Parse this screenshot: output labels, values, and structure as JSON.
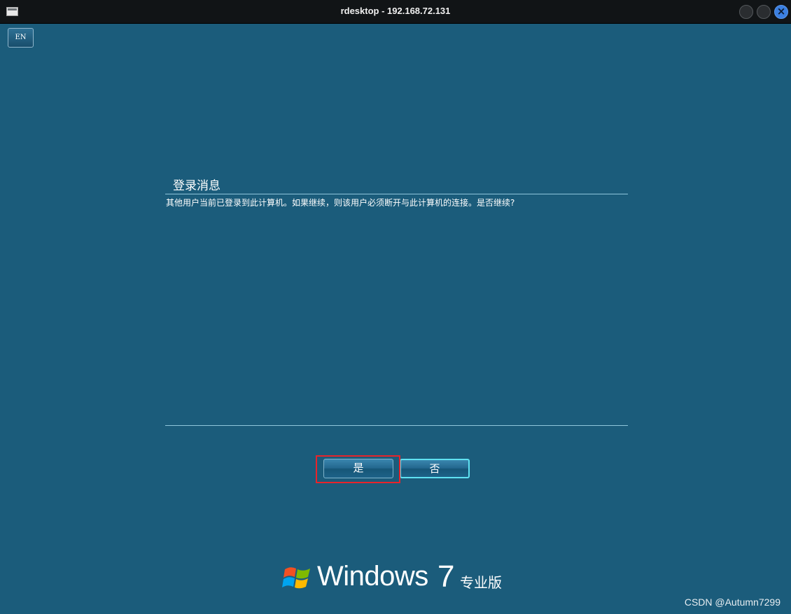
{
  "window": {
    "title": "rdesktop - 192.168.72.131",
    "close_glyph": "×"
  },
  "language_indicator": "EN",
  "dialog": {
    "title": "登录消息",
    "message": "其他用户当前已登录到此计算机。如果继续，则该用户必须断开与此计算机的连接。是否继续?",
    "yes_label": "是",
    "no_label": "否"
  },
  "brand": {
    "word": "Windows",
    "version": "7",
    "edition": "专业版"
  },
  "watermark": "CSDN @Autumn7299",
  "colors": {
    "background": "#1b5c7b",
    "highlight_box": "#e8242a",
    "focus_border": "#5fe2f2"
  }
}
